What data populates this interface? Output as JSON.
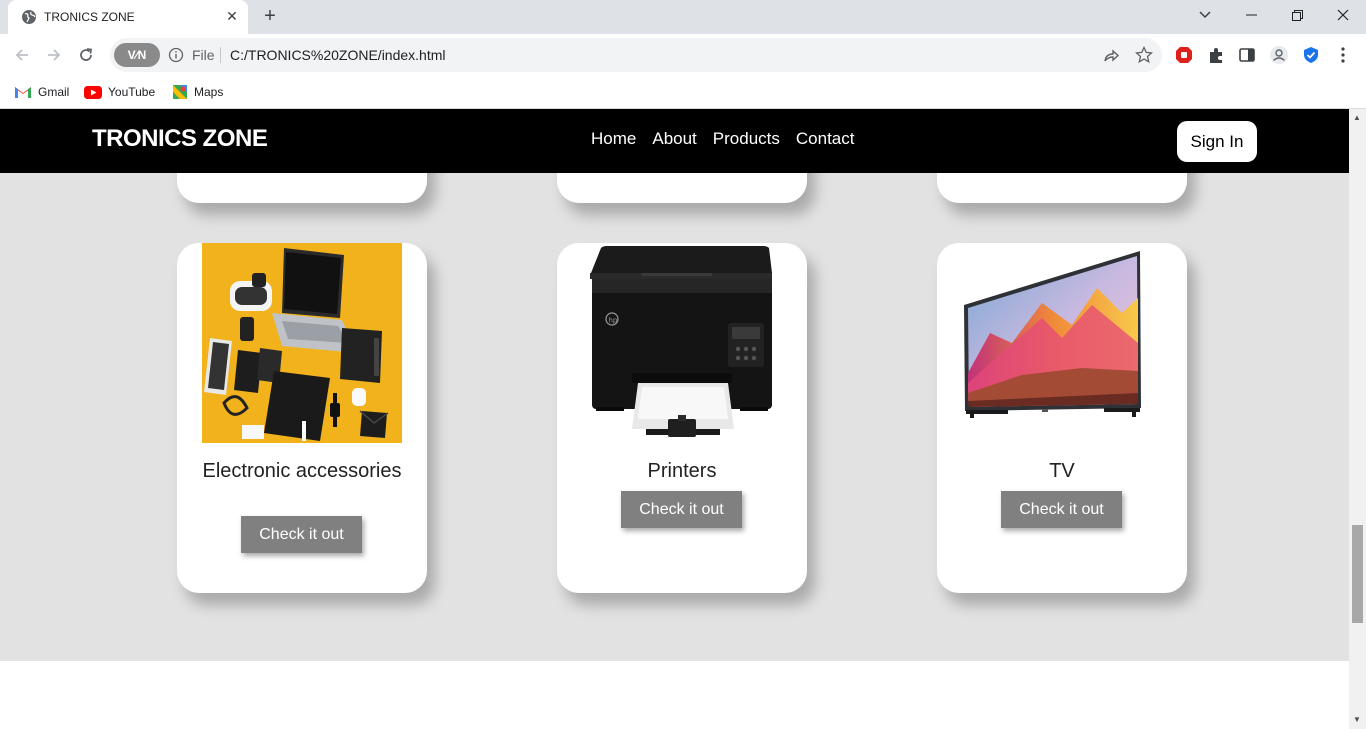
{
  "browser": {
    "tab_title": "TRONICS ZONE",
    "new_tab": "+",
    "file_label": "File",
    "url": "C:/TRONICS%20ZONE/index.html",
    "vpn_label": "V∕N"
  },
  "bookmarks": [
    {
      "label": "Gmail",
      "icon": "gmail-icon"
    },
    {
      "label": "YouTube",
      "icon": "youtube-icon"
    },
    {
      "label": "Maps",
      "icon": "maps-icon"
    }
  ],
  "site": {
    "brand": "TRONICS ZONE",
    "nav": [
      "Home",
      "About",
      "Products",
      "Contact"
    ],
    "signin": "Sign In"
  },
  "products": [
    {
      "title": "Electronic accessories",
      "button": "Check it out",
      "image": "accessories-flatlay"
    },
    {
      "title": "Printers",
      "button": "Check it out",
      "image": "hp-printer"
    },
    {
      "title": "TV",
      "button": "Check it out",
      "image": "flat-tv"
    }
  ],
  "colors": {
    "header_bg": "#000000",
    "page_bg": "#e2e2e2",
    "button_bg": "#808080",
    "accessories_bg": "#f2b21c"
  }
}
